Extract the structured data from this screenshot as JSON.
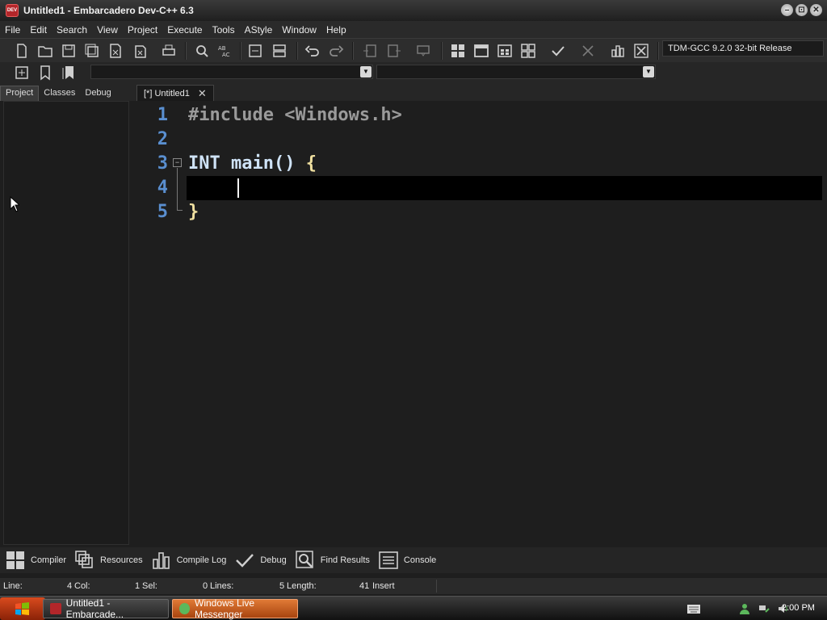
{
  "window": {
    "title": "Untitled1 - Embarcadero Dev-C++ 6.3",
    "app_icon_text": "DEV",
    "buttons": {
      "minimize": "–",
      "restore": "⊡",
      "close": "✕"
    }
  },
  "menu": [
    "File",
    "Edit",
    "Search",
    "View",
    "Project",
    "Execute",
    "Tools",
    "AStyle",
    "Window",
    "Help"
  ],
  "toolbar": {
    "compiler_select": "TDM-GCC 9.2.0 32-bit Release"
  },
  "left_tabs": [
    "Project",
    "Classes",
    "Debug"
  ],
  "editor": {
    "tab_label": "[*] Untitled1",
    "tab_close": "✕",
    "line_numbers": [
      "1",
      "2",
      "3",
      "4",
      "5"
    ],
    "lines": {
      "l1": "#include <Windows.h>",
      "l3_kw": "INT",
      "l3_rest": " main() ",
      "l3_brace": "{",
      "l5": "}"
    },
    "fold_marker": "−"
  },
  "bottom_tabs": [
    "Compiler",
    "Resources",
    "Compile Log",
    "Debug",
    "Find Results",
    "Console"
  ],
  "status": {
    "line_label": "Line:",
    "line_value": "4",
    "col_label": "Col:",
    "col_value": "1",
    "sel_label": "Sel:",
    "sel_value": "0",
    "lines_label": "Lines:",
    "lines_value": "5",
    "length_label": "Length:",
    "length_value": "41",
    "mode": "Insert"
  },
  "taskbar": {
    "task_devcpp": "Untitled1 - Embarcade...",
    "task_messenger": "Windows Live Messenger",
    "clock": "2:00 PM"
  },
  "colors": {
    "accent_line_numbers": "#5a8fd0",
    "editor_bg": "#1e1e1e",
    "current_line_bg": "#000000",
    "taskbar_active": "#e07a36"
  }
}
